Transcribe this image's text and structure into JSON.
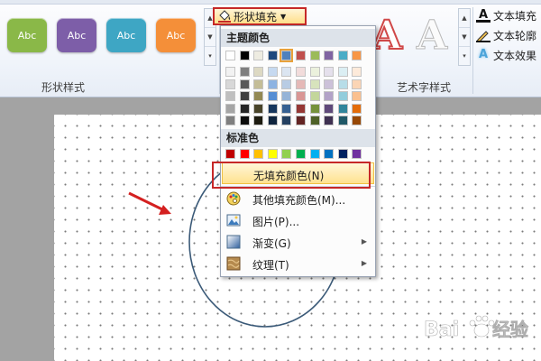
{
  "ribbon": {
    "group_shape_styles": "形状样式",
    "group_wordart_styles": "艺术字样式",
    "shape_style_thumbs": [
      {
        "label": "Abc",
        "color": "#8ab848"
      },
      {
        "label": "Abc",
        "color": "#7d5ea8"
      },
      {
        "label": "Abc",
        "color": "#3ea6c4"
      },
      {
        "label": "Abc",
        "color": "#f48f39"
      }
    ],
    "shape_fill": "形状填充",
    "wordart_letter": "A",
    "text_fill": "文本填充",
    "text_outline": "文本轮廓",
    "text_effects": "文本效果"
  },
  "menu": {
    "theme_colors_header": "主题颜色",
    "standard_colors_header": "标准色",
    "theme_top_row": [
      "#ffffff",
      "#000000",
      "#eeece1",
      "#1f497d",
      "#4f81bd",
      "#c0504d",
      "#9bbb59",
      "#8064a2",
      "#4bacc6",
      "#f79646"
    ],
    "theme_shades": [
      [
        "#f2f2f2",
        "#7f7f7f",
        "#ddd9c3",
        "#c6d9f0",
        "#dbe5f1",
        "#f2dcdb",
        "#ebf1dd",
        "#e5e0ec",
        "#dbeef3",
        "#fdeada"
      ],
      [
        "#d8d8d8",
        "#595959",
        "#c4bd97",
        "#8db3e2",
        "#b8cce4",
        "#e5b9b7",
        "#d7e3bc",
        "#ccc1d9",
        "#b7dde8",
        "#fbd5b5"
      ],
      [
        "#bfbfbf",
        "#3f3f3f",
        "#938953",
        "#548dd4",
        "#95b3d7",
        "#d99694",
        "#c3d69b",
        "#b2a2c7",
        "#92cddc",
        "#fac08f"
      ],
      [
        "#a5a5a5",
        "#262626",
        "#494429",
        "#17365d",
        "#366092",
        "#953734",
        "#76923c",
        "#5f497a",
        "#31859b",
        "#e36c09"
      ],
      [
        "#7f7f7f",
        "#0c0c0c",
        "#1d1b10",
        "#0f243e",
        "#244061",
        "#632423",
        "#4f6128",
        "#3f3151",
        "#205867",
        "#974806"
      ]
    ],
    "standard_colors": [
      "#c00000",
      "#ff0000",
      "#ffc000",
      "#ffff00",
      "#92d050",
      "#00b050",
      "#00b0f0",
      "#0070c0",
      "#002060",
      "#7030a0"
    ],
    "items": {
      "no_fill": "无填充颜色(N)",
      "more_colors": "其他填充颜色(M)...",
      "picture": "图片(P)...",
      "gradient": "渐变(G)",
      "texture": "纹理(T)"
    }
  },
  "colors": {
    "highlight_red": "#c62828",
    "circle_outline": "#3b5a78"
  }
}
